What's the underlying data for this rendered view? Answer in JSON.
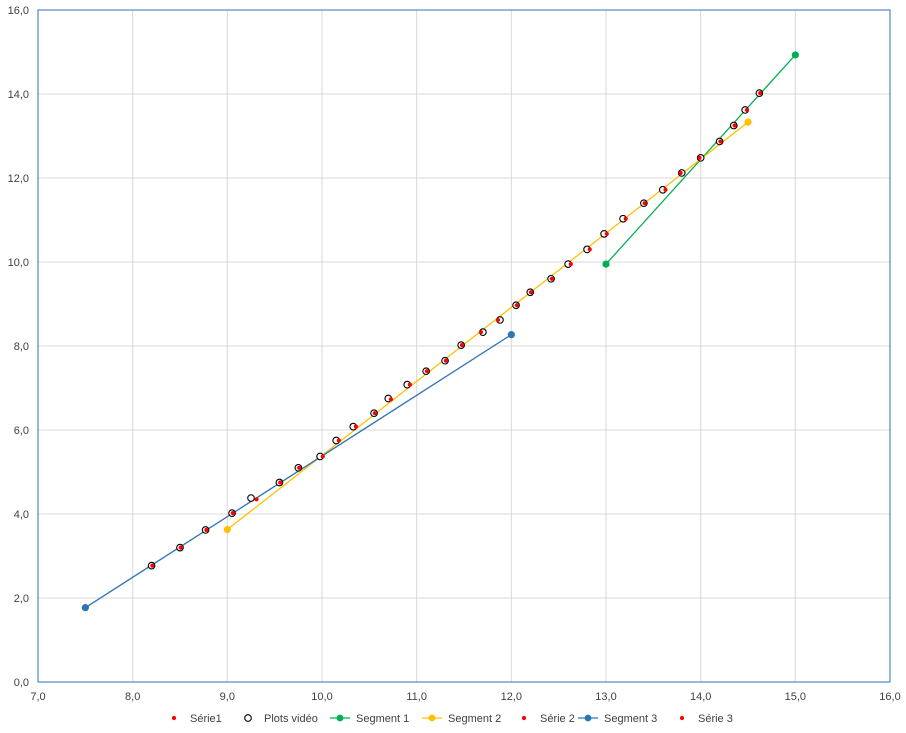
{
  "chart_data": {
    "type": "scatter",
    "title": "",
    "xlabel": "",
    "ylabel": "",
    "xlim": [
      7.0,
      16.0
    ],
    "ylim": [
      0.0,
      16.0
    ],
    "x_ticks": [
      "7,0",
      "8,0",
      "9,0",
      "10,0",
      "11,0",
      "12,0",
      "13,0",
      "14,0",
      "15,0",
      "16,0"
    ],
    "y_ticks": [
      "0,0",
      "2,0",
      "4,0",
      "6,0",
      "8,0",
      "10,0",
      "12,0",
      "14,0",
      "16,0"
    ],
    "grid": true,
    "legend_position": "bottom",
    "series": [
      {
        "name": "Série1",
        "style": "dot",
        "color": "#ff0000",
        "x": [
          8.2,
          8.5,
          8.77,
          9.05,
          9.3,
          9.55,
          9.75,
          10.0,
          10.17,
          10.35,
          10.55,
          10.72,
          10.92,
          11.1,
          11.3,
          11.47,
          11.67
        ],
        "y": [
          2.77,
          3.2,
          3.62,
          4.02,
          4.35,
          4.75,
          5.1,
          5.37,
          5.75,
          6.08,
          6.4,
          6.73,
          7.08,
          7.4,
          7.65,
          8.02,
          8.33
        ]
      },
      {
        "name": "Plots vidéo",
        "style": "ring",
        "color": "#000000",
        "x": [
          8.2,
          8.5,
          8.77,
          9.05,
          9.25,
          9.55,
          9.75,
          9.98,
          10.15,
          10.33,
          10.55,
          10.7,
          10.9,
          11.1,
          11.3,
          11.47,
          11.7,
          11.88,
          12.05,
          12.2,
          12.42,
          12.6,
          12.8,
          12.98,
          13.18,
          13.4,
          13.6,
          13.8,
          14.0,
          14.2,
          14.35,
          14.47,
          14.62
        ],
        "y": [
          2.77,
          3.2,
          3.62,
          4.02,
          4.38,
          4.75,
          5.1,
          5.37,
          5.75,
          6.08,
          6.4,
          6.75,
          7.08,
          7.4,
          7.65,
          8.02,
          8.33,
          8.62,
          8.97,
          9.28,
          9.6,
          9.95,
          10.3,
          10.67,
          11.03,
          11.4,
          11.72,
          12.12,
          12.48,
          12.87,
          13.25,
          13.62,
          14.02
        ]
      },
      {
        "name": "Segment 1",
        "style": "line",
        "color": "#00b050",
        "x": [
          13.0,
          15.0
        ],
        "y": [
          9.95,
          14.93
        ]
      },
      {
        "name": "Segment 2",
        "style": "line",
        "color": "#ffc000",
        "x": [
          9.0,
          14.5
        ],
        "y": [
          3.63,
          13.33
        ]
      },
      {
        "name": "Série 2",
        "style": "dot",
        "color": "#ff0000",
        "x": [
          11.85,
          12.05,
          12.2,
          12.42,
          12.62,
          12.82,
          13.0,
          13.2,
          13.4,
          13.62,
          13.78,
          13.98
        ],
        "y": [
          8.62,
          8.97,
          9.28,
          9.6,
          9.95,
          10.3,
          10.67,
          11.03,
          11.4,
          11.72,
          12.12,
          12.48
        ]
      },
      {
        "name": "Segment 3",
        "style": "line",
        "color": "#2e75b6",
        "x": [
          7.5,
          12.0
        ],
        "y": [
          1.77,
          8.27
        ]
      },
      {
        "name": "Série 3",
        "style": "dot",
        "color": "#ff0000",
        "x": [
          14.2,
          14.35,
          14.48,
          14.62
        ],
        "y": [
          12.87,
          13.25,
          13.62,
          14.02
        ]
      }
    ]
  }
}
